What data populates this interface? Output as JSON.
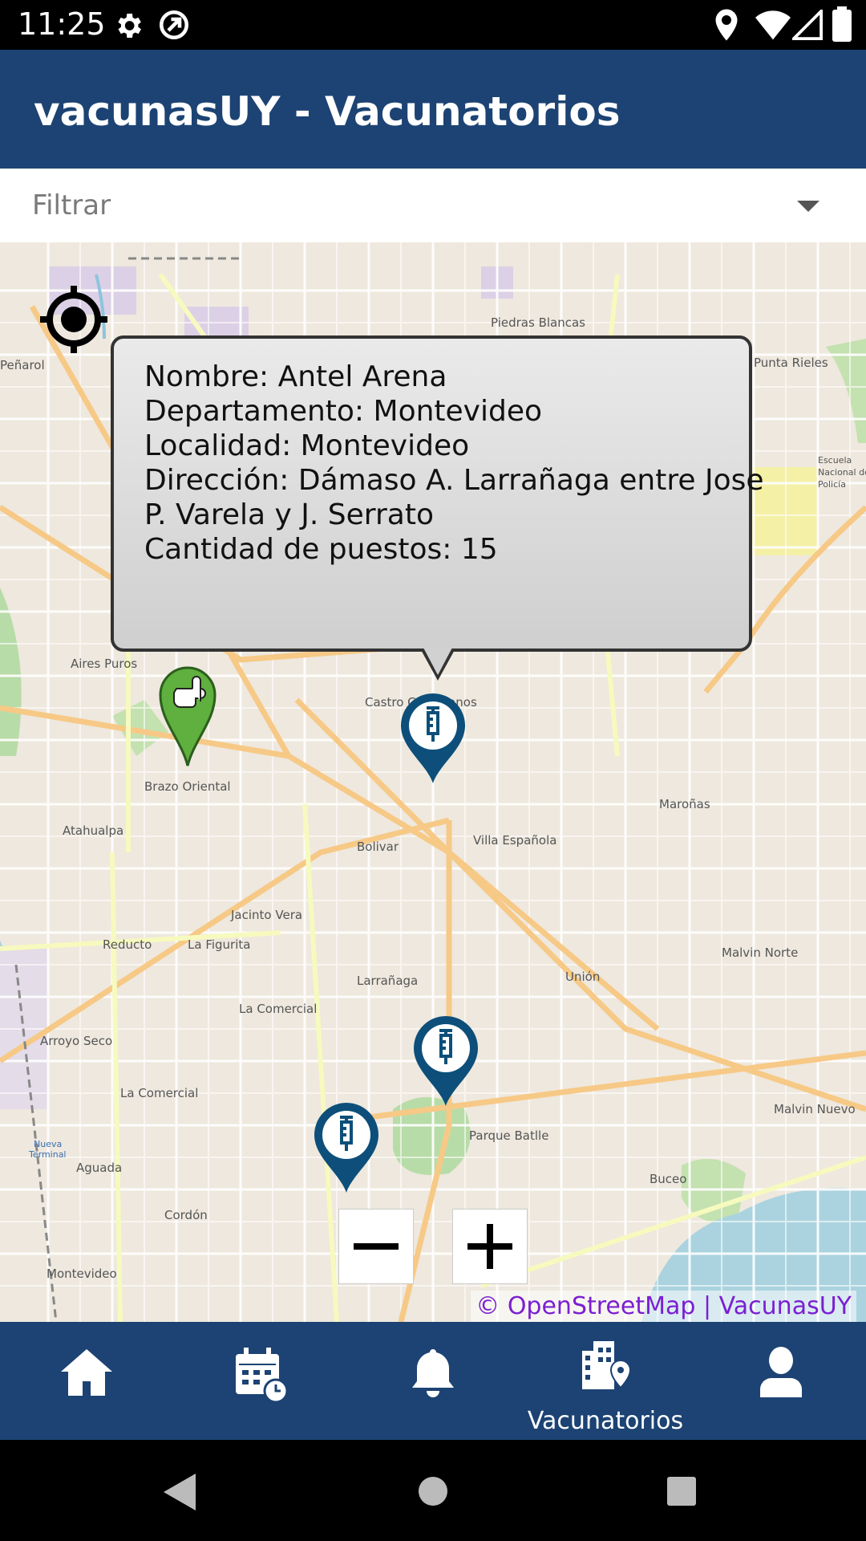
{
  "status_bar": {
    "time": "11:25",
    "icons": [
      "gear-icon",
      "sync-icon",
      "location-icon",
      "wifi-icon",
      "signal-icon",
      "battery-icon"
    ]
  },
  "app_bar": {
    "title": "vacunasUY - Vacunatorios"
  },
  "filter": {
    "placeholder": "Filtrar",
    "icon": "chevron-down-icon"
  },
  "map": {
    "place_labels": [
      "Piedras Blancas",
      "Peñarol",
      "Aires Puros",
      "Castro Castellanos",
      "Brazo Oriental",
      "Atahualpa",
      "Bolivar",
      "Villa Española",
      "Maroñas",
      "Jacinto Vera",
      "La Figurita",
      "Reducto",
      "Larrañaga",
      "Unión",
      "Malvin Norte",
      "La Comercial",
      "Arroyo Seco",
      "Parque Batlle",
      "Buceo",
      "Malvin Nuevo",
      "Aguada",
      "Cordón",
      "Montevideo",
      "Nueva Terminal",
      "Punta Rieles",
      "Escuela Nacional de Policía"
    ],
    "attribution": "© OpenStreetMap | VacunasUY"
  },
  "popup": {
    "lines": [
      "Nombre: Antel Arena",
      "Departamento: Montevideo",
      "Localidad: Montevideo",
      "Dirección: Dámaso A. Larrañaga entre Jose",
      "P. Varela y J. Serrato",
      "Cantidad de puestos: 15"
    ]
  },
  "markers": [
    {
      "type": "user-location",
      "icon": "hand-pointer-icon",
      "color": "#4caf50"
    },
    {
      "type": "vacunatorio",
      "icon": "syringe-icon",
      "color": "#0d4f7a"
    },
    {
      "type": "vacunatorio",
      "icon": "syringe-icon",
      "color": "#0d4f7a"
    },
    {
      "type": "vacunatorio",
      "icon": "syringe-icon",
      "color": "#0d4f7a"
    }
  ],
  "zoom": {
    "minus": "−",
    "plus": "+"
  },
  "bottom_nav": {
    "items": [
      {
        "icon": "home-icon",
        "label": ""
      },
      {
        "icon": "calendar-clock-icon",
        "label": ""
      },
      {
        "icon": "bell-icon",
        "label": ""
      },
      {
        "icon": "building-location-icon",
        "label": "Vacunatorios",
        "active": true
      },
      {
        "icon": "user-icon",
        "label": ""
      }
    ]
  },
  "colors": {
    "primary": "#1c4373",
    "accent_link": "#7b1fd1",
    "marker_blue": "#0d4f7a",
    "marker_green": "#4caf50"
  }
}
